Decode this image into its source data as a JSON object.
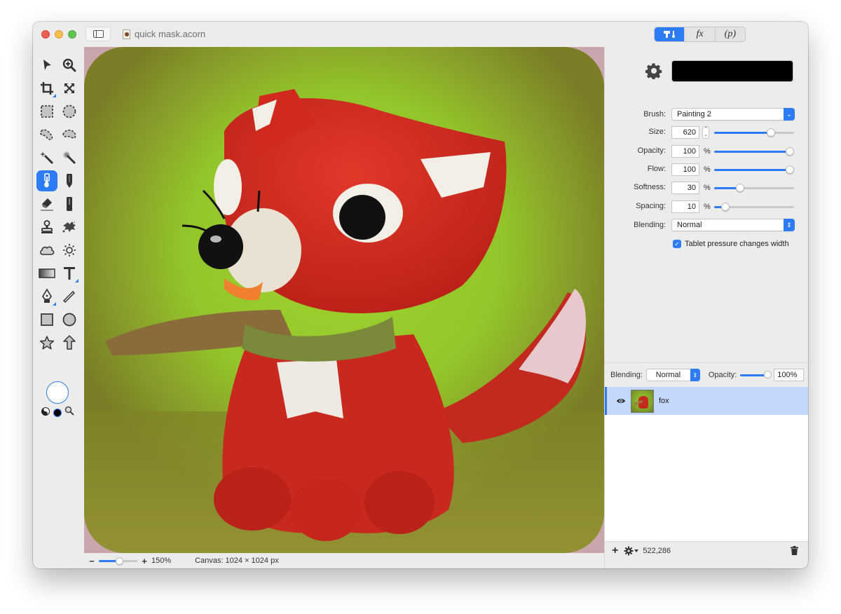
{
  "window": {
    "title": "quick mask.acorn",
    "traffic_lights": [
      "close",
      "minimize",
      "zoom"
    ]
  },
  "titlebar": {
    "sidebar_toggle_icon": "sidebar-icon",
    "segments": [
      {
        "name": "tools",
        "label": "",
        "icon": "hammer-brush-icon",
        "active": true
      },
      {
        "name": "filters",
        "label": "fx",
        "active": false
      },
      {
        "name": "properties",
        "label": "(p)",
        "active": false
      }
    ]
  },
  "toolbar": {
    "tools": [
      {
        "id": "move",
        "icon": "arrow-pointer-icon"
      },
      {
        "id": "zoom",
        "icon": "zoom-in-icon"
      },
      {
        "id": "crop",
        "icon": "crop-icon",
        "has_submenu": true
      },
      {
        "id": "transform",
        "icon": "resize-arrows-icon"
      },
      {
        "id": "rect-select",
        "icon": "rect-marquee-icon"
      },
      {
        "id": "ellipse-select",
        "icon": "ellipse-marquee-icon"
      },
      {
        "id": "lasso",
        "icon": "lasso-icon"
      },
      {
        "id": "polygon-lasso",
        "icon": "polygon-lasso-icon"
      },
      {
        "id": "magic-wand",
        "icon": "magic-wand-icon"
      },
      {
        "id": "instant-alpha",
        "icon": "instant-alpha-icon"
      },
      {
        "id": "brush",
        "icon": "brush-icon",
        "selected": true
      },
      {
        "id": "pencil",
        "icon": "pencil-icon"
      },
      {
        "id": "eraser",
        "icon": "eraser-icon"
      },
      {
        "id": "smudge",
        "icon": "marker-icon"
      },
      {
        "id": "clone",
        "icon": "stamp-icon"
      },
      {
        "id": "retouch",
        "icon": "splatter-icon"
      },
      {
        "id": "burn",
        "icon": "cloud-icon"
      },
      {
        "id": "dodge",
        "icon": "sun-icon"
      },
      {
        "id": "gradient",
        "icon": "gradient-icon"
      },
      {
        "id": "text",
        "icon": "text-icon",
        "has_submenu": true
      },
      {
        "id": "bezier",
        "icon": "pen-nib-icon",
        "has_submenu": true
      },
      {
        "id": "line",
        "icon": "line-icon"
      },
      {
        "id": "rect-shape",
        "icon": "rectangle-icon"
      },
      {
        "id": "oval-shape",
        "icon": "oval-icon"
      },
      {
        "id": "star-shape",
        "icon": "star-icon"
      },
      {
        "id": "arrow-shape",
        "icon": "arrow-up-icon"
      }
    ],
    "colors": {
      "fill": "#ffffff",
      "swap_icon": "yin-yang-icon",
      "stroke": "#000000",
      "picker_icon": "magnifier-icon"
    }
  },
  "canvas": {
    "image_subject": "felt fox plush on green background",
    "mask_color": "#c9a6ac"
  },
  "statusbar": {
    "zoom_minus": "−",
    "zoom_plus": "+",
    "zoom_level": "150%",
    "zoom_slider_fraction": 0.55,
    "canvas_info": "Canvas: 1024 × 1024 px"
  },
  "inspector": {
    "color_well": "#000000",
    "brush": {
      "label": "Brush:",
      "value": "Painting 2"
    },
    "size": {
      "label": "Size:",
      "value": "620",
      "fraction": 0.74
    },
    "opacity": {
      "label": "Opacity:",
      "value": "100",
      "unit": "%",
      "fraction": 1.0
    },
    "flow": {
      "label": "Flow:",
      "value": "100",
      "unit": "%",
      "fraction": 1.0
    },
    "softness": {
      "label": "Softness:",
      "value": "30",
      "unit": "%",
      "fraction": 0.3
    },
    "spacing": {
      "label": "Spacing:",
      "value": "10",
      "unit": "%",
      "fraction": 0.1
    },
    "blending": {
      "label": "Blending:",
      "value": "Normal"
    },
    "tablet_pressure": {
      "label": "Tablet pressure changes width",
      "checked": true
    }
  },
  "layers": {
    "blending_label": "Blending:",
    "blending_value": "Normal",
    "opacity_label": "Opacity:",
    "opacity_value": "100%",
    "opacity_fraction": 1.0,
    "items": [
      {
        "name": "fox",
        "visible": true,
        "selected": true
      }
    ],
    "footer": {
      "add_label": "+",
      "count": "522,286"
    }
  }
}
